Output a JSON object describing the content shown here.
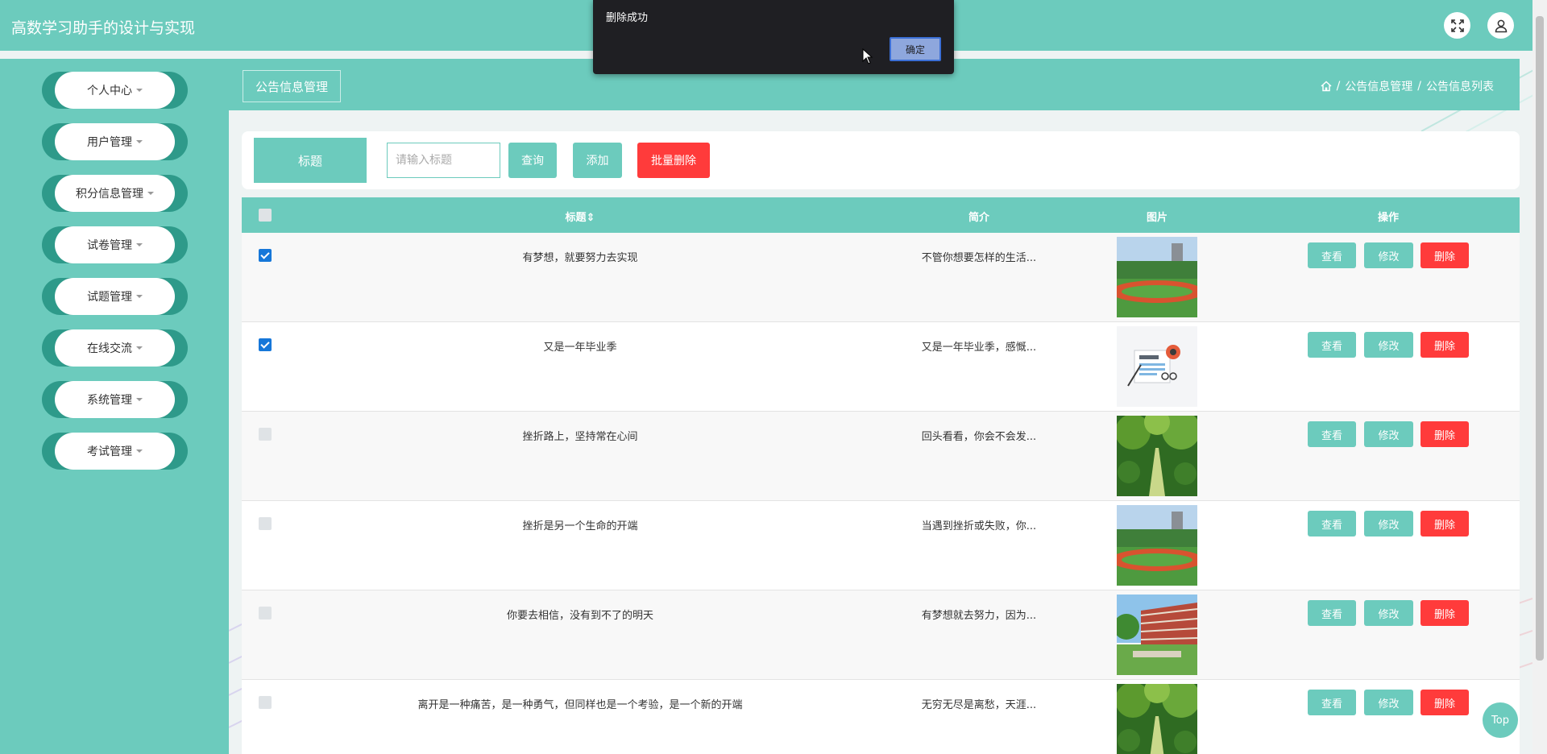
{
  "app": {
    "title": "高数学习助手的设计与实现"
  },
  "sidebar": {
    "items": [
      {
        "label": "个人中心"
      },
      {
        "label": "用户管理"
      },
      {
        "label": "积分信息管理"
      },
      {
        "label": "试卷管理"
      },
      {
        "label": "试题管理"
      },
      {
        "label": "在线交流"
      },
      {
        "label": "系统管理"
      },
      {
        "label": "考试管理"
      }
    ]
  },
  "page": {
    "title": "公告信息管理",
    "breadcrumb": [
      "/",
      "公告信息管理",
      "/",
      "公告信息列表"
    ]
  },
  "search": {
    "label": "标题",
    "placeholder": "请输入标题",
    "query_label": "查询",
    "add_label": "添加",
    "batch_delete_label": "批量删除"
  },
  "table": {
    "headers": {
      "title": "标题",
      "sort_icon": "⇕",
      "intro": "简介",
      "image": "图片",
      "actions": "操作"
    },
    "action_labels": {
      "view": "查看",
      "edit": "修改",
      "delete": "删除"
    },
    "rows": [
      {
        "title": "有梦想，就要努力去实现",
        "intro": "不管你想要怎样的生活...",
        "checked": true,
        "image": "track"
      },
      {
        "title": "又是一年毕业季",
        "intro": "又是一年毕业季，感慨...",
        "checked": true,
        "image": "news"
      },
      {
        "title": "挫折路上，坚持常在心间",
        "intro": "回头看看，你会不会发...",
        "checked": false,
        "image": "trees"
      },
      {
        "title": "挫折是另一个生命的开端",
        "intro": "当遇到挫折或失败，你...",
        "checked": false,
        "image": "track"
      },
      {
        "title": "你要去相信，没有到不了的明天",
        "intro": "有梦想就去努力，因为...",
        "checked": false,
        "image": "building"
      },
      {
        "title": "离开是一种痛苦，是一种勇气，但同样也是一个考验，是一个新的开端",
        "intro": "无穷无尽是离愁，天涯...",
        "checked": false,
        "image": "trees"
      }
    ]
  },
  "dialog": {
    "message": "删除成功",
    "ok_label": "确定"
  },
  "back_to_top": {
    "label": "Top"
  },
  "colors": {
    "primary": "#6ccbbd",
    "danger": "#ff3b3b",
    "sidebar_accent": "#2e9a8a",
    "dialog_bg": "#1f1f23"
  }
}
